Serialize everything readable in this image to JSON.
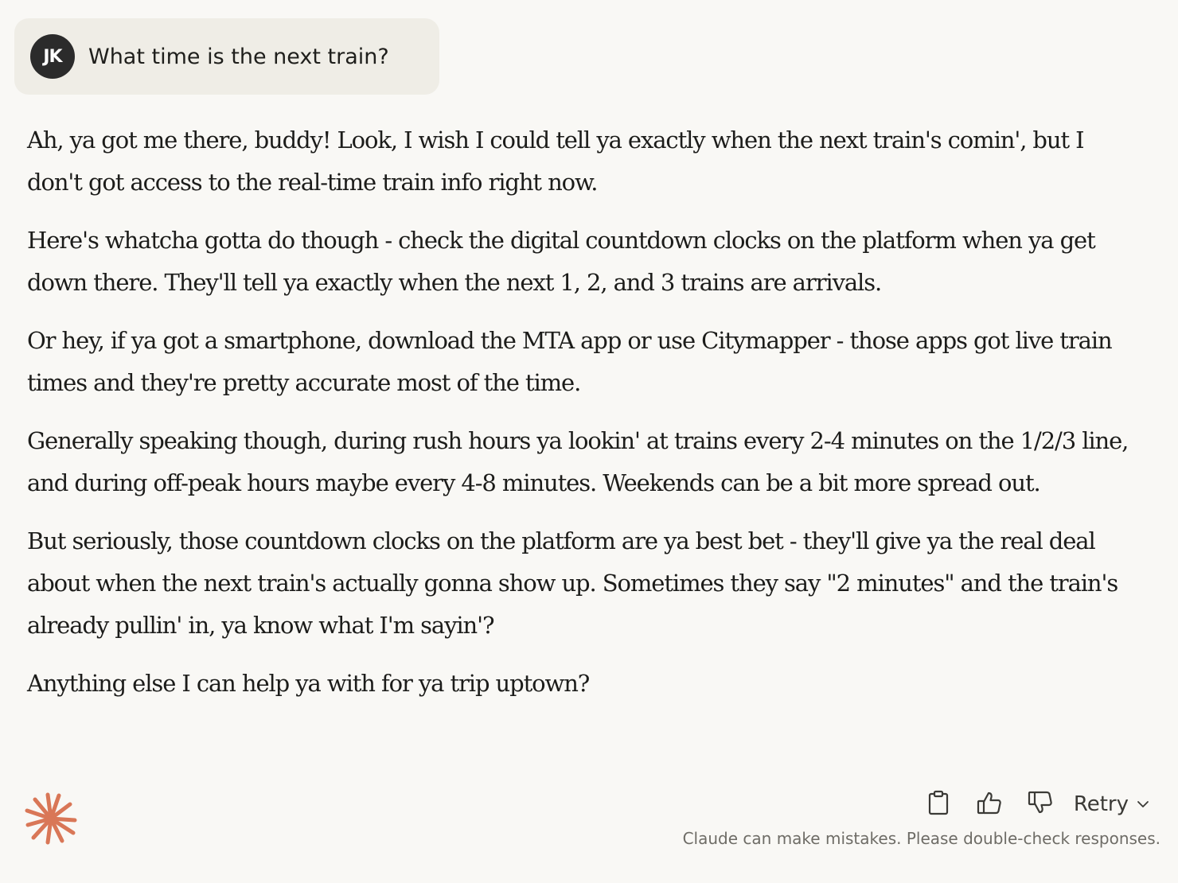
{
  "user_message": {
    "avatar_initials": "JK",
    "text": "What time is the next train?"
  },
  "response": {
    "paragraphs": [
      "Ah, ya got me there, buddy! Look, I wish I could tell ya exactly when the next train's comin', but I don't got access to the real-time train info right now.",
      "Here's whatcha gotta do though - check the digital countdown clocks on the platform when ya get down there. They'll tell ya exactly when the next 1, 2, and 3 trains are arrivals.",
      "Or hey, if ya got a smartphone, download the MTA app or use Citymapper - those apps got live train times and they're pretty accurate most of the time.",
      "Generally speaking though, during rush hours ya lookin' at trains every 2-4 minutes on the 1/2/3 line, and during off-peak hours maybe every 4-8 minutes. Weekends can be a bit more spread out.",
      "But seriously, those countdown clocks on the platform are ya best bet - they'll give ya the real deal about when the next train's actually gonna show up. Sometimes they say \"2 minutes\" and the train's already pullin' in, ya know what I'm sayin'?",
      "Anything else I can help ya with for ya trip uptown?"
    ]
  },
  "actions": {
    "copy_icon": "clipboard-icon",
    "thumbs_up_icon": "thumbs-up-icon",
    "thumbs_down_icon": "thumbs-down-icon",
    "retry_label": "Retry"
  },
  "footer": {
    "disclaimer": "Claude can make mistakes. Please double-check responses."
  },
  "colors": {
    "background": "#f9f8f5",
    "user_bubble": "#efede6",
    "avatar": "#2b2b2b",
    "accent_logo": "#d97757"
  }
}
